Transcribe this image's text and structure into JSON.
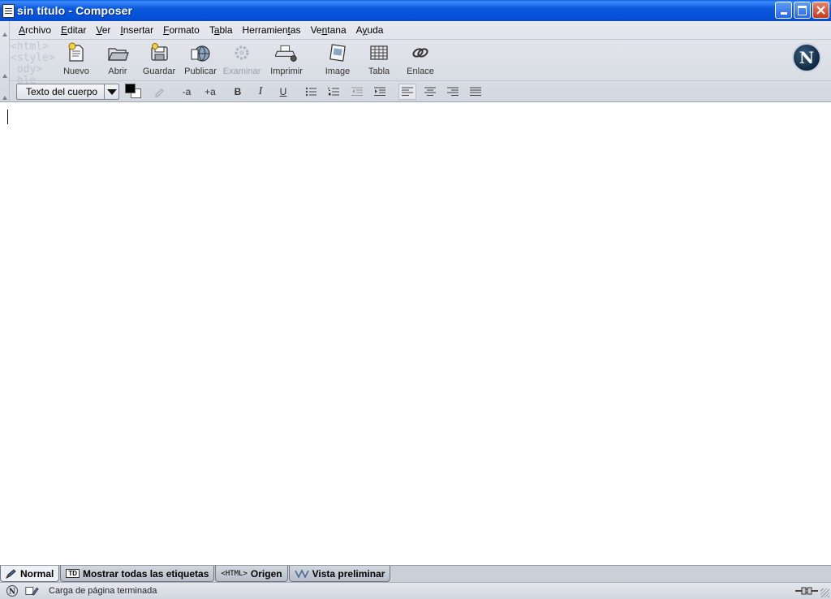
{
  "window": {
    "title": "sin título - Composer"
  },
  "menu": [
    {
      "label": "Archivo",
      "key": "A",
      "rest": "rchivo"
    },
    {
      "label": "Editar",
      "key": "E",
      "rest": "ditar"
    },
    {
      "label": "Ver",
      "key": "V",
      "rest": "er"
    },
    {
      "label": "Insertar",
      "key": "I",
      "rest": "nsertar"
    },
    {
      "label": "Formato",
      "key": "F",
      "rest": "ormato"
    },
    {
      "label": "Tabla",
      "key": "a",
      "pre": "T",
      "rest": "bla"
    },
    {
      "label": "Herramientas",
      "pre": "Herramien",
      "key": "t",
      "rest": "as"
    },
    {
      "label": "Ventana",
      "pre": "Ve",
      "key": "n",
      "rest": "tana"
    },
    {
      "label": "Ayuda",
      "pre": "A",
      "key": "y",
      "rest": "uda"
    }
  ],
  "toolbar": {
    "watermark": "<html>\n<style>\n ody>\n ble",
    "nuevo": "Nuevo",
    "abrir": "Abrir",
    "guardar": "Guardar",
    "publicar": "Publicar",
    "examinar": "Examinar",
    "imprimir": "Imprimir",
    "image": "Image",
    "tabla": "Tabla",
    "enlace": "Enlace",
    "logo_letter": "N"
  },
  "format": {
    "paragraph_style": "Texto del cuerpo",
    "smaller": "-a",
    "larger": "+a",
    "bold": "B",
    "italic": "I",
    "underline": "U",
    "text_color": "#000000",
    "background_color": "#ffffff"
  },
  "tabs": [
    {
      "label": "Normal",
      "active": true
    },
    {
      "label": "Mostrar todas las etiquetas",
      "badge": "TD"
    },
    {
      "label": "Origen",
      "prefix": "<HTML>"
    },
    {
      "label": "Vista preliminar"
    }
  ],
  "status": {
    "text": "Carga de página terminada"
  }
}
